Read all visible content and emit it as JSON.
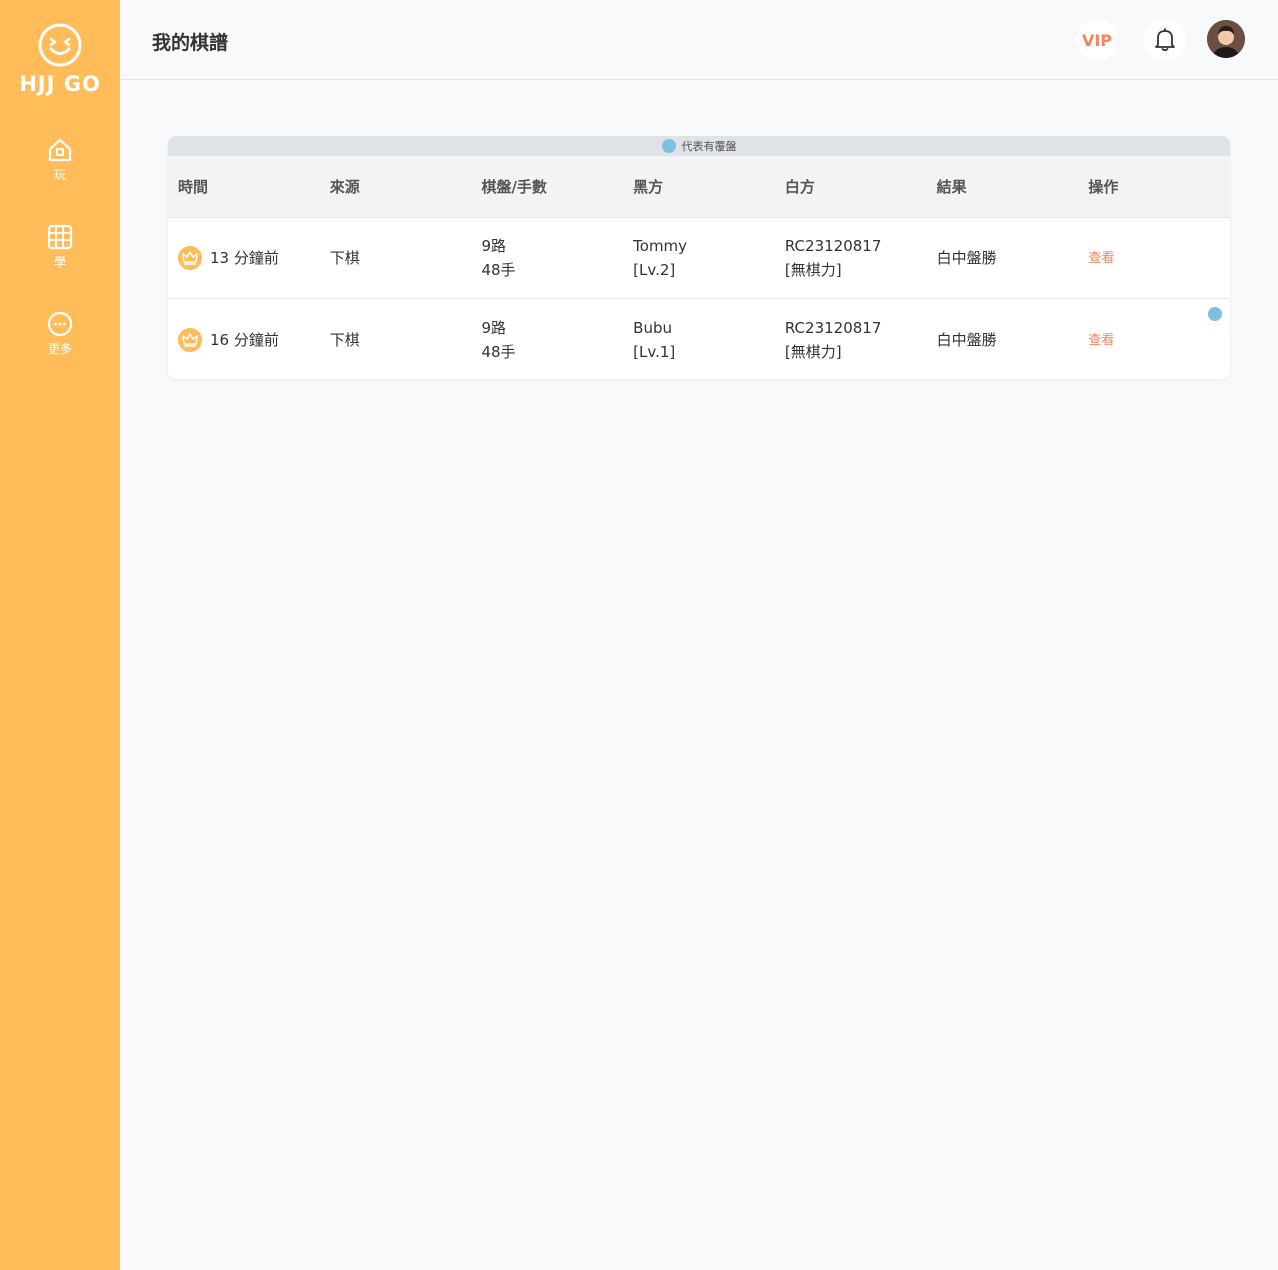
{
  "sidebar": {
    "logo_text": "HJJ GO",
    "items": [
      {
        "label": "玩",
        "icon": "home-icon"
      },
      {
        "label": "學",
        "icon": "board-icon"
      },
      {
        "label": "更多",
        "icon": "more-icon"
      }
    ],
    "bg_color": "#ffbc58"
  },
  "header": {
    "title": "我的棋譜",
    "vip_label": "VIP"
  },
  "legend": {
    "text": "代表有覆盤",
    "dot_color": "#7ec0df"
  },
  "table": {
    "columns": [
      "時間",
      "來源",
      "棋盤/手數",
      "黑方",
      "白方",
      "結果",
      "操作"
    ],
    "rows": [
      {
        "time": "13 分鐘前",
        "source": "下棋",
        "board": "9路",
        "moves": "48手",
        "black_name": "Tommy",
        "black_level": "[Lv.2]",
        "white_name": "RC23120817",
        "white_level": "[無棋力]",
        "result": "白中盤勝",
        "action": "查看",
        "reviewed": false
      },
      {
        "time": "16 分鐘前",
        "source": "下棋",
        "board": "9路",
        "moves": "48手",
        "black_name": "Bubu",
        "black_level": "[Lv.1]",
        "white_name": "RC23120817",
        "white_level": "[無棋力]",
        "result": "白中盤勝",
        "action": "查看",
        "reviewed": true
      }
    ]
  },
  "colors": {
    "accent": "#ffbc58",
    "link": "#f4845f",
    "review": "#7ec0df"
  }
}
